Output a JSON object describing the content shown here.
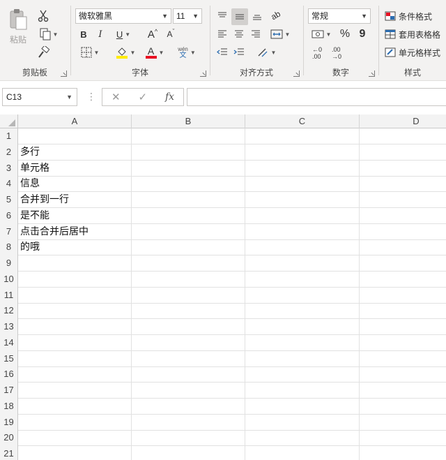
{
  "ribbon": {
    "clipboard": {
      "paste_label": "粘贴",
      "group_label": "剪贴板"
    },
    "font": {
      "font_name": "微软雅黑",
      "font_size": "11",
      "bold": "B",
      "italic": "I",
      "underline": "U",
      "grow": "A",
      "shrink": "A",
      "font_color_letter": "A",
      "phonetic_top": "wén",
      "phonetic_bottom": "文",
      "group_label": "字体",
      "highlight_color": "#ffeb00",
      "font_color": "#e81123"
    },
    "alignment": {
      "orientation_label": "ab",
      "group_label": "对齐方式"
    },
    "number": {
      "format": "常规",
      "percent": "%",
      "comma": "9",
      "inc_decimal_top": "←0",
      "inc_decimal_bottom": ".00",
      "dec_decimal_top": ".00",
      "dec_decimal_bottom": "→0",
      "group_label": "数字"
    },
    "styles": {
      "conditional": "条件格式",
      "table_format": "套用表格格",
      "cell_styles": "单元格样式",
      "group_label": "样式"
    }
  },
  "formula_bar": {
    "name_box": "C13",
    "cancel": "✕",
    "enter": "✓",
    "fx": "fx",
    "value": ""
  },
  "sheet": {
    "columns": [
      "A",
      "B",
      "C",
      "D"
    ],
    "rows": [
      {
        "num": "1",
        "a": ""
      },
      {
        "num": "2",
        "a": "多行"
      },
      {
        "num": "3",
        "a": "单元格"
      },
      {
        "num": "4",
        "a": "信息"
      },
      {
        "num": "5",
        "a": "合并到一行"
      },
      {
        "num": "6",
        "a": "是不能"
      },
      {
        "num": "7",
        "a": "点击合并后居中"
      },
      {
        "num": "8",
        "a": "的哦"
      },
      {
        "num": "9",
        "a": ""
      },
      {
        "num": "10",
        "a": ""
      },
      {
        "num": "11",
        "a": ""
      },
      {
        "num": "12",
        "a": ""
      },
      {
        "num": "13",
        "a": ""
      },
      {
        "num": "14",
        "a": ""
      },
      {
        "num": "15",
        "a": ""
      },
      {
        "num": "16",
        "a": ""
      },
      {
        "num": "17",
        "a": ""
      },
      {
        "num": "18",
        "a": ""
      },
      {
        "num": "19",
        "a": ""
      },
      {
        "num": "20",
        "a": ""
      },
      {
        "num": "21",
        "a": ""
      }
    ]
  }
}
